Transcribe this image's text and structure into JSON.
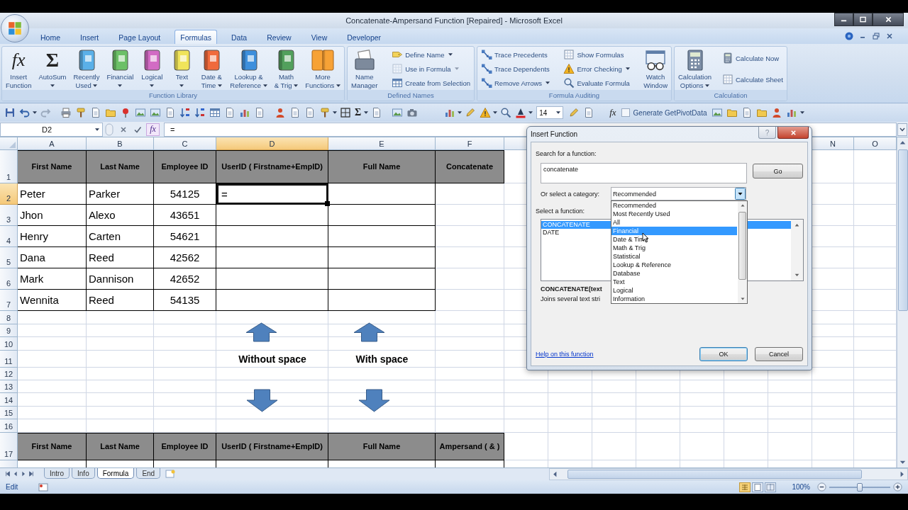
{
  "window": {
    "title": "Concatenate-Ampersand Function [Repaired] - Microsoft Excel"
  },
  "ribbon": {
    "tabs": [
      {
        "label": "Home",
        "selected": false
      },
      {
        "label": "Insert",
        "selected": false
      },
      {
        "label": "Page Layout",
        "selected": false
      },
      {
        "label": "Formulas",
        "selected": true
      },
      {
        "label": "Data",
        "selected": false
      },
      {
        "label": "Review",
        "selected": false
      },
      {
        "label": "View",
        "selected": false
      },
      {
        "label": "Developer",
        "selected": false
      }
    ],
    "groups": [
      {
        "label": "Function Library",
        "items": [
          {
            "kind": "large",
            "glyph": "fx",
            "label": "Insert\nFunction",
            "dropdown": false,
            "disabled": false
          },
          {
            "kind": "large",
            "glyph": "Σ",
            "label": "AutoSum",
            "dropdown": true,
            "disabled": false
          },
          {
            "kind": "large",
            "label": "Recently\nUsed",
            "dropdown": true,
            "disabled": false
          },
          {
            "kind": "large",
            "label": "Financial",
            "dropdown": true,
            "disabled": false
          },
          {
            "kind": "large",
            "label": "Logical",
            "dropdown": true,
            "disabled": false
          },
          {
            "kind": "large",
            "label": "Text",
            "dropdown": true,
            "disabled": false
          },
          {
            "kind": "large",
            "label": "Date &\nTime",
            "dropdown": true,
            "disabled": false
          },
          {
            "kind": "large",
            "label": "Lookup &\nReference",
            "dropdown": true,
            "disabled": false
          },
          {
            "kind": "large",
            "label": "Math\n& Trig",
            "dropdown": true,
            "disabled": false
          },
          {
            "kind": "large",
            "label": "More\nFunctions",
            "dropdown": true,
            "disabled": false
          }
        ]
      },
      {
        "label": "Defined Names",
        "items": [
          {
            "kind": "large",
            "label": "Name\nManager",
            "dropdown": false,
            "disabled": false
          },
          {
            "kind": "small",
            "label": "Define Name",
            "dropdown": true,
            "disabled": false
          },
          {
            "kind": "small",
            "label": "Use in Formula",
            "dropdown": true,
            "disabled": true
          },
          {
            "kind": "small",
            "label": "Create from Selection",
            "dropdown": false,
            "disabled": false
          }
        ]
      },
      {
        "label": "Formula Auditing",
        "items": [
          {
            "kind": "small",
            "label": "Trace Precedents",
            "dropdown": false,
            "disabled": false
          },
          {
            "kind": "small",
            "label": "Trace Dependents",
            "dropdown": false,
            "disabled": false
          },
          {
            "kind": "small",
            "label": "Remove Arrows",
            "dropdown": true,
            "disabled": false
          },
          {
            "kind": "small",
            "label": "Show Formulas",
            "dropdown": false,
            "disabled": false
          },
          {
            "kind": "small",
            "label": "Error Checking",
            "dropdown": true,
            "disabled": false
          },
          {
            "kind": "small",
            "label": "Evaluate Formula",
            "dropdown": false,
            "disabled": false
          },
          {
            "kind": "large",
            "label": "Watch\nWindow",
            "dropdown": false,
            "disabled": false
          }
        ]
      },
      {
        "label": "Calculation",
        "items": [
          {
            "kind": "large",
            "label": "Calculation\nOptions",
            "dropdown": true,
            "disabled": false
          },
          {
            "kind": "small",
            "label": "Calculate Now",
            "dropdown": false,
            "disabled": false
          },
          {
            "kind": "small",
            "label": "Calculate Sheet",
            "dropdown": false,
            "disabled": false
          }
        ]
      }
    ]
  },
  "quick_access_toolbar": {
    "autosum_glyph": "Σ",
    "font_size": "14",
    "function_glyph": "fx",
    "pivot_label": "Generate GetPivotData"
  },
  "formula_bar": {
    "name_box": "D2",
    "function_glyph": "fx",
    "formula": "="
  },
  "sheet": {
    "column_headers": [
      {
        "label": "A",
        "selected": false
      },
      {
        "label": "B",
        "selected": false
      },
      {
        "label": "C",
        "selected": false
      },
      {
        "label": "D",
        "selected": true
      },
      {
        "label": "E",
        "selected": false
      },
      {
        "label": "F",
        "selected": false
      }
    ],
    "column_headers_right": [
      {
        "label": "N",
        "selected": false
      },
      {
        "label": "O",
        "selected": false
      }
    ],
    "row_headers": [
      {
        "label": "1",
        "selected": false
      },
      {
        "label": "2",
        "selected": true
      },
      {
        "label": "3",
        "selected": false
      },
      {
        "label": "4",
        "selected": false
      },
      {
        "label": "5",
        "selected": false
      },
      {
        "label": "6",
        "selected": false
      },
      {
        "label": "7",
        "selected": false
      },
      {
        "label": "8",
        "selected": false
      },
      {
        "label": "9",
        "selected": false
      },
      {
        "label": "10",
        "selected": false
      },
      {
        "label": "11",
        "selected": false
      },
      {
        "label": "12",
        "selected": false
      },
      {
        "label": "13",
        "selected": false
      },
      {
        "label": "14",
        "selected": false
      },
      {
        "label": "15",
        "selected": false
      },
      {
        "label": "16",
        "selected": false
      },
      {
        "label": "17",
        "selected": false
      }
    ],
    "top_table": {
      "header": [
        "First Name",
        "Last Name",
        "Employee ID",
        "UserID ( Firstname+EmpID)",
        "Full Name",
        "Concatenate"
      ],
      "rows": [
        {
          "cells": [
            {
              "text": "Peter",
              "selected": false
            },
            {
              "text": "Parker",
              "selected": false
            },
            {
              "text": "54125",
              "selected": false
            },
            {
              "text": "=",
              "selected": true
            }
          ]
        },
        {
          "cells": [
            {
              "text": "Jhon",
              "selected": false
            },
            {
              "text": "Alexo",
              "selected": false
            },
            {
              "text": "43651",
              "selected": false
            }
          ]
        },
        {
          "cells": [
            {
              "text": "Henry",
              "selected": false
            },
            {
              "text": "Carten",
              "selected": false
            },
            {
              "text": "54621",
              "selected": false
            }
          ]
        },
        {
          "cells": [
            {
              "text": "Dana",
              "selected": false
            },
            {
              "text": "Reed",
              "selected": false
            },
            {
              "text": "42562",
              "selected": false
            }
          ]
        },
        {
          "cells": [
            {
              "text": "Mark",
              "selected": false
            },
            {
              "text": "Dannison",
              "selected": false
            },
            {
              "text": "42652",
              "selected": false
            }
          ]
        },
        {
          "cells": [
            {
              "text": "Wennita",
              "selected": false
            },
            {
              "text": "Reed",
              "selected": false
            },
            {
              "text": "54135",
              "selected": false
            }
          ]
        }
      ]
    },
    "notes": [
      "Without space",
      "With space"
    ],
    "bottom_table": {
      "header": [
        "First Name",
        "Last Name",
        "Employee ID",
        "UserID ( Firstname+EmpID)",
        "Full Name",
        "Ampersand ( & )"
      ]
    }
  },
  "sheet_tabs": [
    {
      "label": "Intro",
      "selected": false
    },
    {
      "label": "Info",
      "selected": false
    },
    {
      "label": "Formula",
      "selected": true
    },
    {
      "label": "End",
      "selected": false
    }
  ],
  "status_bar": {
    "mode": "Edit",
    "zoom": "100%",
    "zoom_slider": {
      "level": 0.5
    }
  },
  "dialog": {
    "title": "Insert Function",
    "help_button": "?",
    "search_label": "Search for a function:",
    "search_value": "concatenate",
    "go_button": "Go",
    "category_label": "Or select a category:",
    "category_value": "Recommended",
    "category_options": [
      {
        "label": "Recommended",
        "selected": false
      },
      {
        "label": "Most Recently Used",
        "selected": false
      },
      {
        "label": "All",
        "selected": false
      },
      {
        "label": "Financial",
        "selected": true
      },
      {
        "label": "Date & Time",
        "selected": false
      },
      {
        "label": "Math & Trig",
        "selected": false
      },
      {
        "label": "Statistical",
        "selected": false
      },
      {
        "label": "Lookup & Reference",
        "selected": false
      },
      {
        "label": "Database",
        "selected": false
      },
      {
        "label": "Text",
        "selected": false
      },
      {
        "label": "Logical",
        "selected": false
      },
      {
        "label": "Information",
        "selected": false
      }
    ],
    "function_label": "Select a function:",
    "functions": [
      {
        "label": "CONCATENATE",
        "selected": true
      },
      {
        "label": "DATE",
        "selected": false
      }
    ],
    "syntax": "CONCATENATE(text",
    "description": "Joins several text stri",
    "help_link": "Help on this function",
    "buttons": [
      {
        "label": "OK",
        "focused": true
      },
      {
        "label": "Cancel",
        "focused": false
      }
    ]
  }
}
